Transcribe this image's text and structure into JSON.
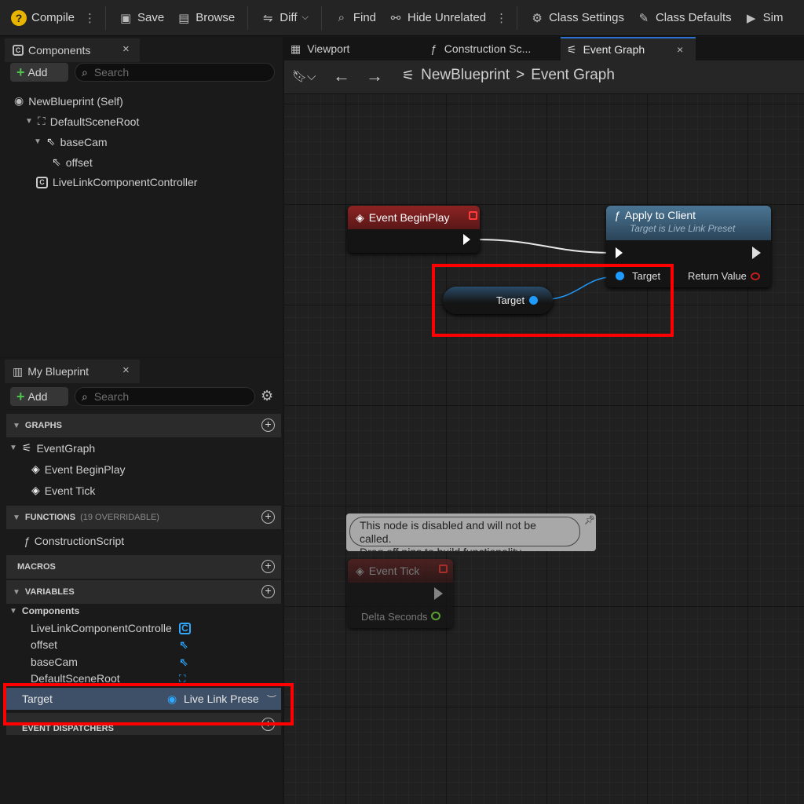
{
  "toolbar": {
    "compile": "Compile",
    "save": "Save",
    "browse": "Browse",
    "diff": "Diff",
    "find": "Find",
    "hide_unrelated": "Hide Unrelated",
    "class_settings": "Class Settings",
    "class_defaults": "Class Defaults",
    "simulate": "Sim"
  },
  "components_panel": {
    "title": "Components",
    "add_label": "Add",
    "search_placeholder": "Search",
    "items": [
      "NewBlueprint (Self)",
      "DefaultSceneRoot",
      "baseCam",
      "offset",
      "LiveLinkComponentController"
    ]
  },
  "tabs": {
    "viewport": "Viewport",
    "construction": "Construction Sc...",
    "event_graph": "Event Graph"
  },
  "breadcrumb": {
    "root": "NewBlueprint",
    "separator": ">",
    "current": "Event Graph"
  },
  "my_blueprint": {
    "title": "My Blueprint",
    "add_label": "Add",
    "search_placeholder": "Search",
    "sections": {
      "graphs": "GRAPHS",
      "functions": "FUNCTIONS",
      "functions_sub": "(19 OVERRIDABLE)",
      "macros": "MACROS",
      "variables": "VARIABLES",
      "event_dispatchers": "EVENT DISPATCHERS"
    },
    "graph_items": [
      "EventGraph",
      "Event BeginPlay",
      "Event Tick"
    ],
    "function_items": [
      "ConstructionScript"
    ],
    "components_label": "Components",
    "variables": [
      "LiveLinkComponentControlle",
      "offset",
      "baseCam",
      "DefaultSceneRoot"
    ],
    "selected_variable": {
      "name": "Target",
      "type": "Live Link Prese"
    }
  },
  "graph": {
    "begin_play": {
      "title": "Event BeginPlay"
    },
    "apply_to_client": {
      "title": "Apply to Client",
      "subtitle": "Target is Live Link Preset",
      "target_pin": "Target",
      "return_pin": "Return Value"
    },
    "target_var_node": {
      "label": "Target"
    },
    "event_tick": {
      "comment_line1": "This node is disabled and will not be called.",
      "comment_line2": "Drag off pins to build functionality.",
      "title": "Event Tick",
      "delta_pin": "Delta Seconds"
    }
  },
  "colors": {
    "event_header": "#7a1d1d",
    "function_header": "#3d5d74",
    "object_pin": "#1e9bff",
    "highlight": "#ff0000",
    "selected_row": "#3e5068"
  }
}
